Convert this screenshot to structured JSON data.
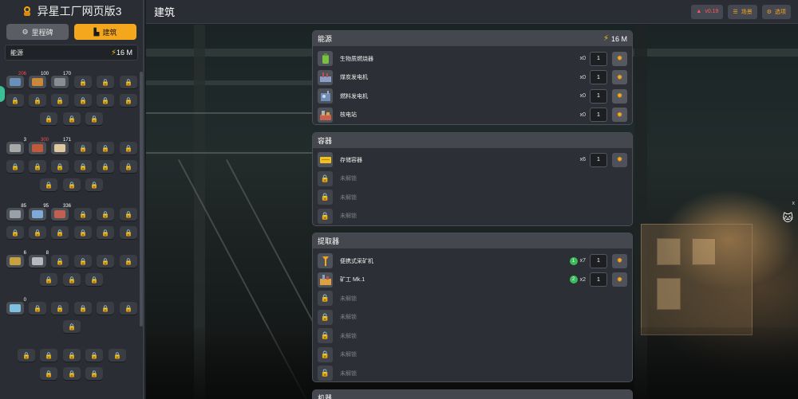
{
  "app": {
    "title": "异星工厂网页版3"
  },
  "mode_tabs": [
    {
      "label": "里程碑",
      "icon": "milestone-icon",
      "active": false
    },
    {
      "label": "建筑",
      "icon": "factory-icon",
      "active": true
    }
  ],
  "sidebar": {
    "energy_label": "能源",
    "energy_value": "16 M",
    "item_counts": [
      "206",
      "100",
      "170",
      "3",
      "300",
      "171",
      "85",
      "95",
      "336",
      "6",
      "8",
      "0"
    ]
  },
  "header": {
    "title": "建筑",
    "version": "v0.19",
    "scene_label": "场景",
    "options_label": "选项"
  },
  "sections": {
    "energy": {
      "title": "能源",
      "power": "16 M",
      "rows": [
        {
          "name": "生物质燃烧器",
          "qty": "x0",
          "amount": "1"
        },
        {
          "name": "煤炭发电机",
          "qty": "x0",
          "amount": "1"
        },
        {
          "name": "燃料发电机",
          "qty": "x0",
          "amount": "1"
        },
        {
          "name": "核电站",
          "qty": "x0",
          "amount": "1"
        }
      ]
    },
    "storage": {
      "title": "容器",
      "rows": [
        {
          "name": "存储容器",
          "qty": "x6",
          "amount": "1"
        }
      ],
      "locked": [
        "未解锁",
        "未解锁",
        "未解锁"
      ]
    },
    "extractor": {
      "title": "提取器",
      "rows": [
        {
          "name": "便携式采矿机",
          "tier": "1",
          "qty": "x7",
          "amount": "1"
        },
        {
          "name": "矿工 Mk.1",
          "tier": "2",
          "qty": "x2",
          "amount": "1"
        }
      ],
      "locked": [
        "未解锁",
        "未解锁",
        "未解锁",
        "未解锁",
        "未解锁"
      ]
    },
    "machines": {
      "title": "机器"
    }
  },
  "side_close": "x",
  "colors": {
    "accent": "#f4a61c",
    "danger": "#ff5959",
    "tier": "#3dbb5a"
  }
}
